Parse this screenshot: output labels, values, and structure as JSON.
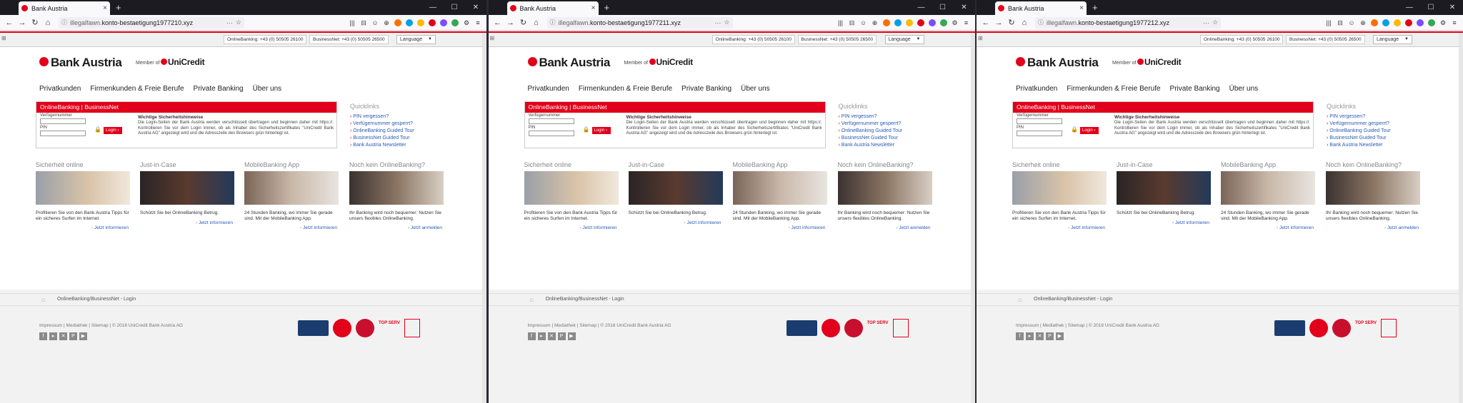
{
  "browser": {
    "tab_title": "Bank Austria",
    "tab_close": "×",
    "new_tab": "+",
    "window_controls": [
      "—",
      "☐",
      "✕"
    ],
    "nav_buttons": [
      "←",
      "→",
      "↻",
      "⌂"
    ],
    "toolbar_icons": [
      "|||",
      "⊟",
      "☺",
      "⊕",
      "⚙",
      "≡"
    ],
    "page_action": "···",
    "extension_colors": [
      "#ff6d00",
      "#00a0e3",
      "#fbbc05",
      "#e2001a",
      "#7c4dff",
      "#34a853"
    ],
    "windows": [
      {
        "url_host": "illegalfawn.",
        "url_rest": "konto-bestaetigung1977210.xyz"
      },
      {
        "url_host": "illegalfawn.",
        "url_rest": "konto-bestaetigung1977211.xyz"
      },
      {
        "url_host": "illegalfawn.",
        "url_rest": "konto-bestaetigung1977212.xyz"
      }
    ]
  },
  "colors": {
    "brand_red": "#e2001a",
    "link_blue": "#2a5bb7"
  },
  "page": {
    "service_bar": {
      "online_banking": "OnlineBanking: +43 (0) 50505 26100",
      "business_net": "BusinessNet: +43 (0) 50505 26500",
      "language": "Language",
      "language_caret": "▼"
    },
    "logo": {
      "bank": "Bank Austria",
      "member_of": "Member of",
      "unicredit": "UniCredit"
    },
    "nav": [
      "Privatkunden",
      "Firmenkunden & Freie Berufe",
      "Private Banking",
      "Über uns"
    ],
    "login": {
      "header": "OnlineBanking | BusinessNet",
      "field1_label": "Verfügernummer",
      "field2_label": "PIN",
      "button": "Login ›",
      "lock_icon": "🔒",
      "security_heading": "Wichtige Sicherheitshinweise",
      "security_text": "Die Login-Seiten der Bank Austria werden verschlüsselt übertragen und beginnen daher mit https://. Kontrollieren Sie vor dem Login immer, ob als Inhaber des Sicherheitszertifikates \"UniCredit Bank Austria AG\" angezeigt wird und die Adresszeile des Browsers grün hinterlegt ist."
    },
    "quicklinks": {
      "header": "Quicklinks",
      "items": [
        "PIN vergessen?",
        "Verfügernummer gesperrt?",
        "OnlineBanking Guided Tour",
        "BusinessNet Guided Tour",
        "Bank Austria Newsletter"
      ]
    },
    "teasers": [
      {
        "title": "Sicherheit online",
        "text": "Profitieren Sie von den Bank Austria Tipps für ein sicheres Surfen im Internet.",
        "link": "Jetzt informieren"
      },
      {
        "title": "Just-in-Case",
        "text": "Schützt Sie bei OnlineBanking Betrug.",
        "link": "Jetzt informieren"
      },
      {
        "title": "MobileBanking App",
        "text": "24 Stunden Banking, wo immer Sie gerade sind. Mit der MobileBanking App.",
        "link": "Jetzt informieren"
      },
      {
        "title": "Noch kein OnlineBanking?",
        "text": "Ihr Banking wird noch bequemer: Nutzen Sie unsers flexibles OnlineBanking.",
        "link": "Jetzt anmelden"
      }
    ],
    "breadcrumb": {
      "home_icon": "⌂",
      "text": "OnlineBanking/BusinessNet - Login"
    },
    "footer": {
      "links": "Impressum  |  Mediathek  |  Sitemap  |  © 2018 UniCredit Bank Austria AG",
      "social": [
        "f",
        "▸",
        "✕",
        "P",
        "▶"
      ],
      "badge_top_serv": "TOP SERV"
    }
  }
}
